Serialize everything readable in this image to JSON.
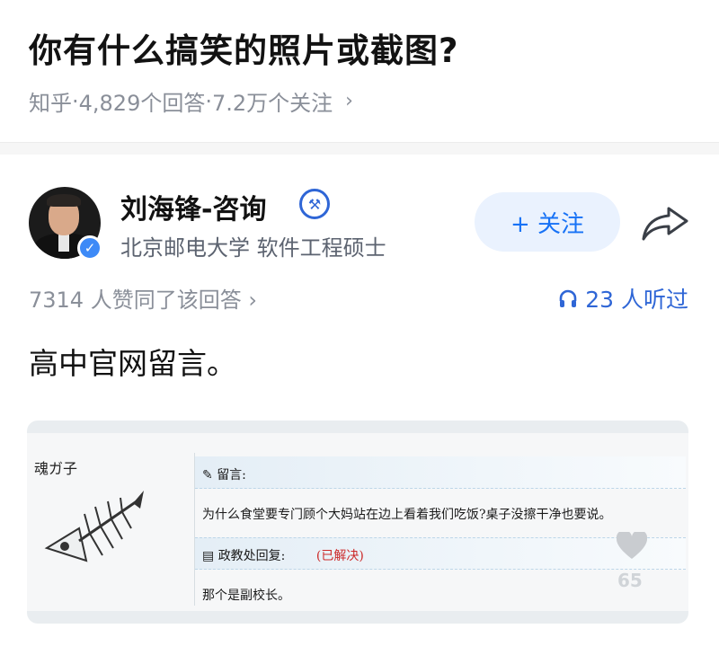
{
  "question": {
    "title": "你有什么搞笑的照片或截图?",
    "source": "知乎",
    "answers_count": "4,829个回答",
    "followers_count": "7.2万个关注",
    "separator": " · "
  },
  "author": {
    "name": "刘海锋-咨询",
    "description": "北京邮电大学 软件工程硕士",
    "follow_label": "+ 关注"
  },
  "answer": {
    "votes_text": "7314 人赞同了该回答",
    "listen_count": "23 人听过",
    "text": "高中官网留言。"
  },
  "screenshot": {
    "username": "魂ガ子",
    "message_label": "留言:",
    "message_text": "为什么食堂要专门顾个大妈站在边上看着我们吃饭?桌子没擦干净也要说。",
    "reply_label": "政教处回复:",
    "status": "(已解决)",
    "reply_text": "那个是副校长。",
    "like_count": "65"
  },
  "colors": {
    "accent_blue": "#1772f6",
    "follow_bg": "#eaf2fe",
    "meta_gray": "#8a8f99",
    "solved_red": "#cc2a2a"
  },
  "icons": {
    "chevron": "chevron-right-icon",
    "verified": "verified-check-icon",
    "badge": "hammer-badge-icon",
    "share": "share-arrow-icon",
    "headphones": "headphones-icon",
    "heart": "heart-icon"
  }
}
